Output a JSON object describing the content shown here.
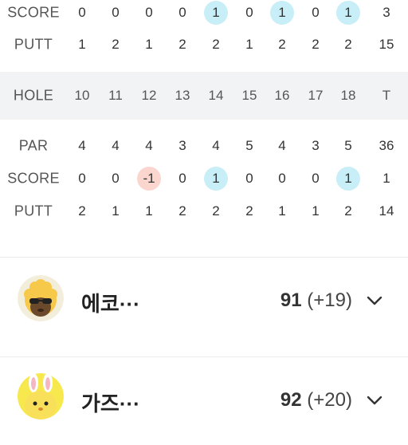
{
  "front": {
    "score_label": "SCORE",
    "putt_label": "PUTT",
    "score": [
      "0",
      "0",
      "0",
      "0",
      "1",
      "0",
      "1",
      "0",
      "1",
      "3"
    ],
    "putt": [
      "1",
      "2",
      "1",
      "2",
      "2",
      "1",
      "2",
      "2",
      "2",
      "15"
    ]
  },
  "back": {
    "hole_label": "HOLE",
    "par_label": "PAR",
    "score_label": "SCORE",
    "putt_label": "PUTT",
    "holes": [
      "10",
      "11",
      "12",
      "13",
      "14",
      "15",
      "16",
      "17",
      "18",
      "T"
    ],
    "par": [
      "4",
      "4",
      "4",
      "3",
      "4",
      "5",
      "4",
      "3",
      "5",
      "36"
    ],
    "score": [
      "0",
      "0",
      "-1",
      "0",
      "1",
      "0",
      "0",
      "0",
      "1",
      "1"
    ],
    "putt": [
      "2",
      "1",
      "1",
      "2",
      "2",
      "2",
      "1",
      "1",
      "2",
      "14"
    ]
  },
  "players": [
    {
      "name": "에코···",
      "total": "91",
      "diff": "(+19)",
      "avatar_icon": "sunglasses-character-icon"
    },
    {
      "name": "가즈···",
      "total": "92",
      "diff": "(+20)",
      "avatar_icon": "bunny-character-icon"
    }
  ],
  "colors": {
    "birdie_highlight": "#fbd6cf",
    "bogey_highlight": "#c8eef8",
    "hole_row_bg": "#f2f3f5"
  }
}
